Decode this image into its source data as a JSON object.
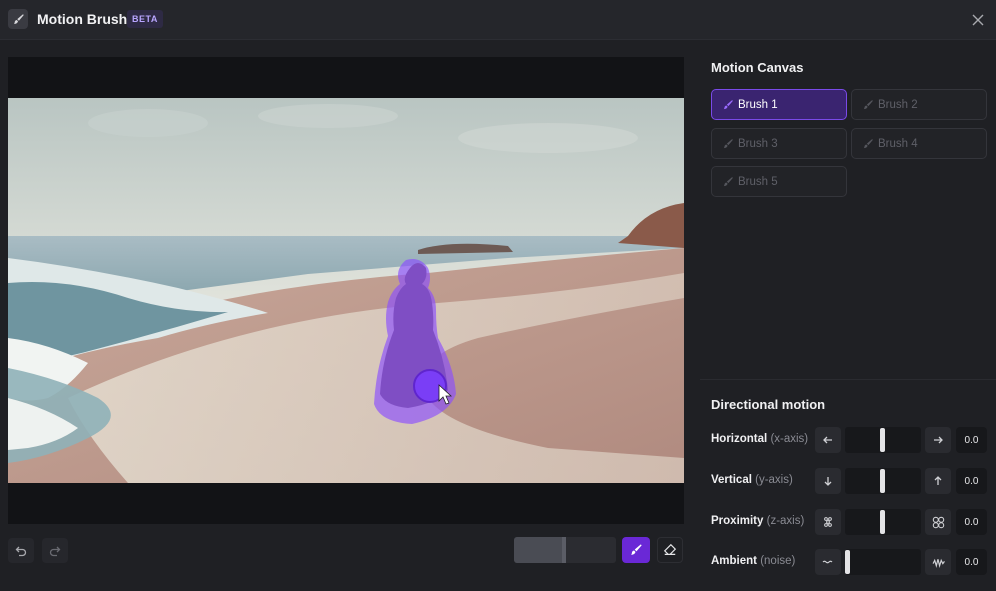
{
  "header": {
    "title": "Motion Brush",
    "badge": "BETA",
    "icons": {
      "app": "brush-icon",
      "close": "close-icon"
    }
  },
  "canvas": {
    "scene": "beach photo with a woman in a long dress walking at the shoreline; subject painted purple by brush",
    "brush_overlay_color": "#8a4dff",
    "cursor_icon": "pointer-cursor-icon"
  },
  "toolbar": {
    "undo_icon": "undo-icon",
    "redo_icon": "redo-icon",
    "brush_size_level": 0.5,
    "brush_icon": "brush-icon",
    "eraser_icon": "eraser-icon"
  },
  "motion_canvas": {
    "title": "Motion Canvas",
    "brushes": [
      {
        "label": "Brush 1",
        "active": true
      },
      {
        "label": "Brush 2",
        "active": false
      },
      {
        "label": "Brush 3",
        "active": false
      },
      {
        "label": "Brush 4",
        "active": false
      },
      {
        "label": "Brush 5",
        "active": false
      }
    ]
  },
  "directional_motion": {
    "title": "Directional motion",
    "rows": [
      {
        "bold": "Horizontal",
        "sub": "(x-axis)",
        "left_icon": "arrow-left-icon",
        "right_icon": "arrow-right-icon",
        "value": "0.0",
        "level": 0.5
      },
      {
        "bold": "Vertical",
        "sub": "(y-axis)",
        "left_icon": "arrow-down-icon",
        "right_icon": "arrow-up-icon",
        "value": "0.0",
        "level": 0.5
      },
      {
        "bold": "Proximity",
        "sub": "(z-axis)",
        "left_icon": "dots-small-icon",
        "right_icon": "dots-large-icon",
        "value": "0.0",
        "level": 0.5
      },
      {
        "bold": "Ambient",
        "sub": "(noise)",
        "left_icon": "wave-small-icon",
        "right_icon": "wave-large-icon",
        "value": "0.0",
        "level": 0.0
      }
    ]
  },
  "colors": {
    "accent": "#6a28d6",
    "panel_bg": "#1f2024"
  }
}
